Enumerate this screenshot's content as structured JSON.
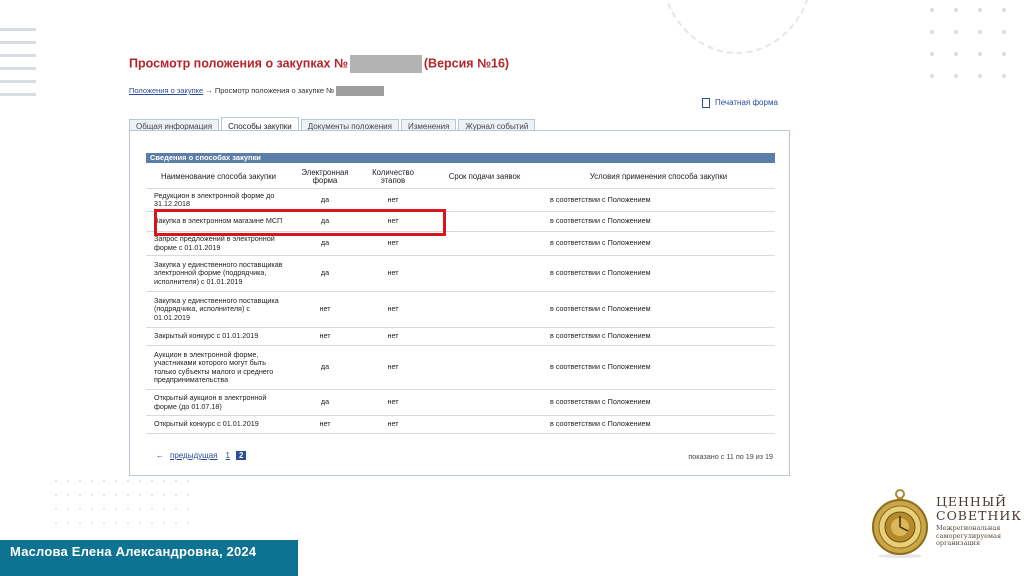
{
  "page": {
    "title_prefix": "Просмотр положения о закупках №",
    "title_suffix": "(Версия №16)",
    "breadcrumb_link": "Положения о закупке",
    "breadcrumb_arrow": "→",
    "breadcrumb_current": "Просмотр положения о закупке №",
    "print_label": "Печатная форма"
  },
  "tabs": [
    {
      "label": "Общая информация",
      "active": false
    },
    {
      "label": "Способы закупки",
      "active": true
    },
    {
      "label": "Документы положения",
      "active": false
    },
    {
      "label": "Изменения",
      "active": false
    },
    {
      "label": "Журнал событий",
      "active": false
    }
  ],
  "section": {
    "title": "Сведения о способах закупки"
  },
  "table": {
    "headers": [
      "Наименование способа закупки",
      "Электронная форма",
      "Количество этапов",
      "Срок подачи заявок",
      "Условия применения способа закупки"
    ],
    "rows": [
      [
        "Редукцион в электронной форме до 31.12.2018",
        "да",
        "нет",
        "",
        "в соответствии с Положением"
      ],
      [
        "Закупка в электронном магазине МСП",
        "да",
        "нет",
        "",
        "в соответствии с Положением"
      ],
      [
        "Запрос предложений в электронной форме с 01.01.2019",
        "да",
        "нет",
        "",
        "в соответствии с Положением"
      ],
      [
        "Закупка у единственного поставщикав электронной форме (подрядчика, исполнителя) с 01.01.2019",
        "да",
        "нет",
        "",
        "в соответствии с Положением"
      ],
      [
        "Закупка у единственного поставщика (подрядчика, исполнителя) с 01.01.2019",
        "нет",
        "нет",
        "",
        "в соответствии с Положением"
      ],
      [
        "Закрытый конкурс с 01.01.2019",
        "нет",
        "нет",
        "",
        "в соответствии с Положением"
      ],
      [
        "Аукцион в электронной форме, участниками которого могут быть только субъекты малого и среднего предпринимательства",
        "да",
        "нет",
        "",
        "в соответствии с Положением"
      ],
      [
        "Открытый аукцион в электронной форме (до 01.07.18)",
        "да",
        "нет",
        "",
        "в соответствии с Положением"
      ],
      [
        "Открытый конкурс с 01.01.2019",
        "нет",
        "нет",
        "",
        "в соответствии с Положением"
      ]
    ]
  },
  "pager": {
    "arrow": "←",
    "prev": "предыдущая",
    "page1": "1",
    "page2": "2",
    "shown": "показано с 11 по 19 из 19"
  },
  "footer": {
    "author": "Маслова Елена Александровна, 2024"
  },
  "logo": {
    "name_line1": "ЦЕННЫЙ",
    "name_line2": "СОВЕТНИК",
    "subtitle_line1": "Межрегиональная",
    "subtitle_line2": "саморегулируемая",
    "subtitle_line3": "организация"
  },
  "colors": {
    "title_red": "#b4262a",
    "header_bar": "#5b7ea9",
    "link_blue": "#2a4c9b",
    "highlight_red": "#d9161e",
    "footer_teal": "#0e7392"
  }
}
